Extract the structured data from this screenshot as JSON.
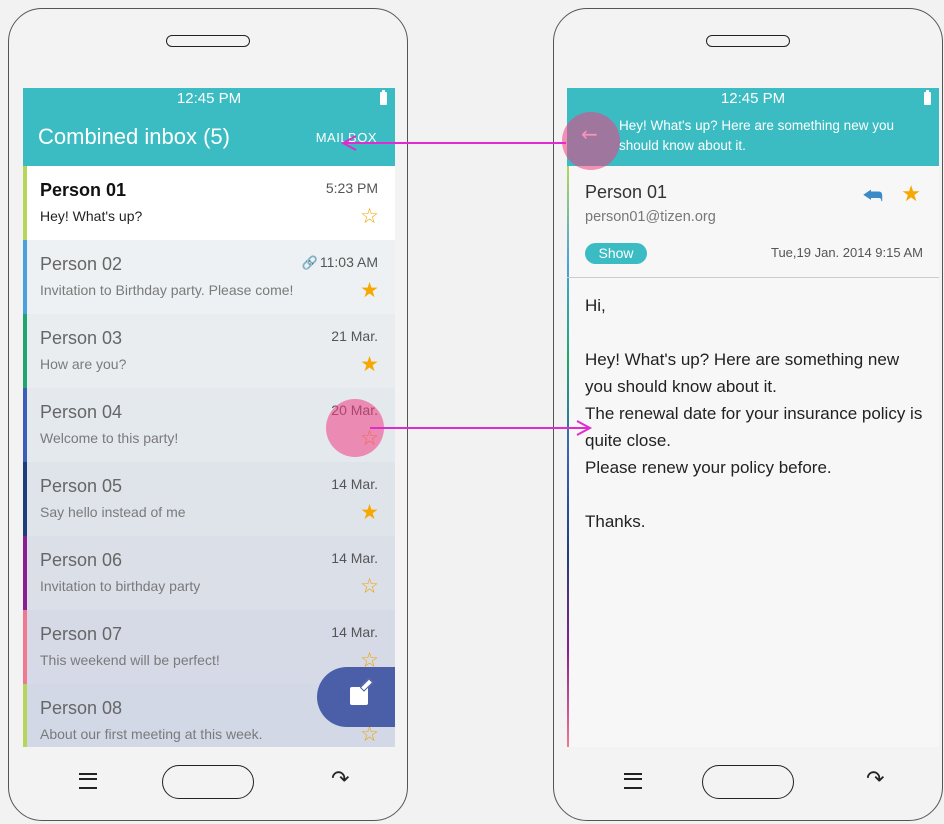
{
  "left_screen": {
    "status_time": "12:45 PM",
    "title": "Combined inbox (5)",
    "mailbox_label": "MAILBOX",
    "mails": [
      {
        "name": "Person 01",
        "subject": "Hey! What's up?",
        "time": "5:23 PM",
        "starred": false,
        "unread": true,
        "color": "#b5d65b",
        "attachment": false
      },
      {
        "name": "Person 02",
        "subject": "Invitation to Birthday party. Please come!",
        "time": "11:03 AM",
        "starred": true,
        "unread": false,
        "color": "#4aa1dd",
        "attachment": true
      },
      {
        "name": "Person 03",
        "subject": "How are you?",
        "time": "21 Mar.",
        "starred": true,
        "unread": false,
        "color": "#1da66d",
        "attachment": false
      },
      {
        "name": "Person 04",
        "subject": "Welcome to this party!",
        "time": "20 Mar.",
        "starred": false,
        "unread": false,
        "color": "#3b5fb8",
        "attachment": false
      },
      {
        "name": "Person 05",
        "subject": "Say hello instead of me",
        "time": "14 Mar.",
        "starred": true,
        "unread": false,
        "color": "#1e3e7a",
        "attachment": false
      },
      {
        "name": "Person 06",
        "subject": "Invitation to birthday party",
        "time": "14 Mar.",
        "starred": false,
        "unread": false,
        "color": "#8b1e8f",
        "attachment": false
      },
      {
        "name": "Person 07",
        "subject": "This weekend will be perfect!",
        "time": "14 Mar.",
        "starred": false,
        "unread": false,
        "color": "#f07890",
        "attachment": false
      },
      {
        "name": "Person 08",
        "subject": "About our first meeting at this week.",
        "time": "",
        "starred": false,
        "unread": false,
        "color": "#b5d65b",
        "attachment": false
      }
    ],
    "compose_icon": "compose-icon"
  },
  "right_screen": {
    "status_time": "12:45 PM",
    "subject": "Hey! What's up? Here are something new you should know about it.",
    "sender_name": "Person 01",
    "sender_email": "person01@tizen.org",
    "show_label": "Show",
    "date": "Tue,19 Jan. 2014 9:15 AM",
    "body_lines": [
      "Hi,",
      "",
      "Hey! What's up? Here are something new you should know about it.",
      "The renewal date for your insurance policy is quite close.",
      "Please renew your policy before.",
      "",
      "Thanks."
    ]
  },
  "colors": {
    "header": "#3bbcc2",
    "star": "#f7a800",
    "fab": "#4a5fa8",
    "annotation": "#e02bd0",
    "touch": "#f03c82"
  }
}
